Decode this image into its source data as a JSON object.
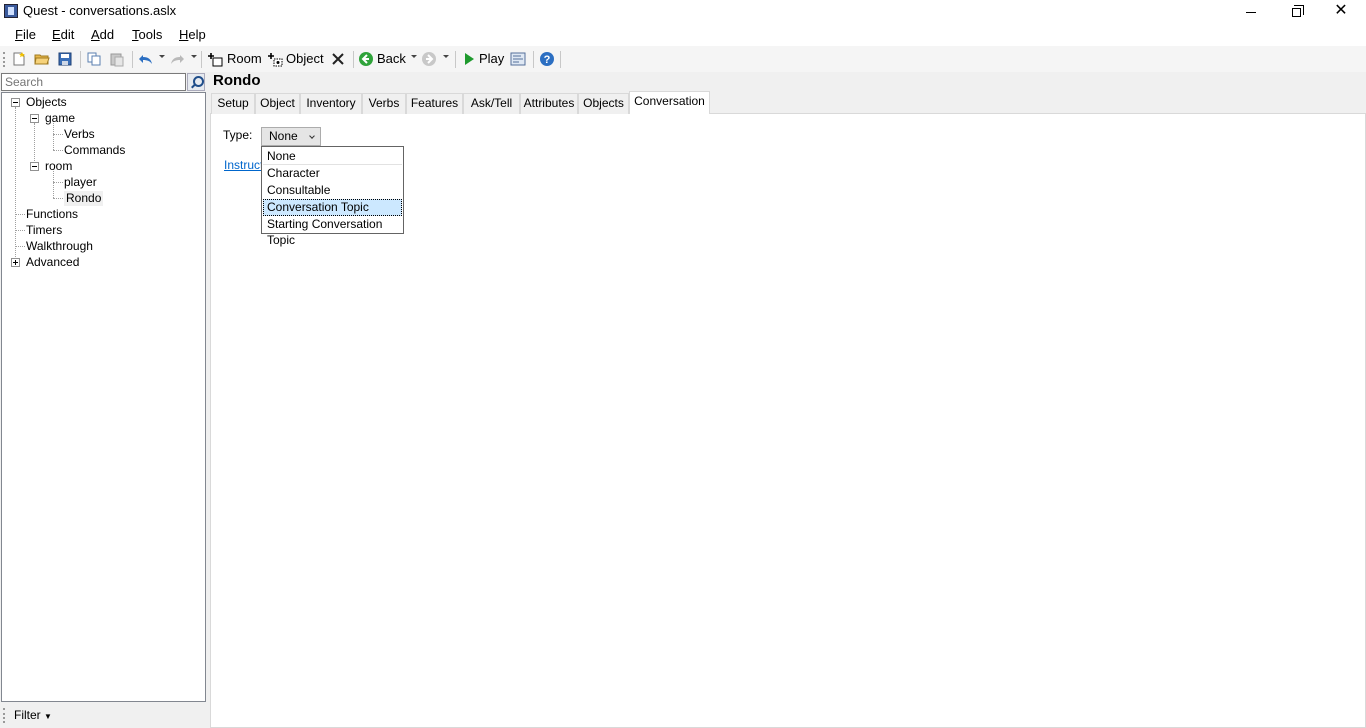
{
  "window": {
    "title": "Quest - conversations.aslx",
    "minimize_icon": "minimize-icon",
    "maximize_icon": "restore-icon",
    "close_glyph": "✕"
  },
  "menu": [
    {
      "label": "File",
      "accel": "F",
      "rest": "ile"
    },
    {
      "label": "Edit",
      "accel": "E",
      "rest": "dit"
    },
    {
      "label": "Add",
      "accel": "A",
      "rest": "dd"
    },
    {
      "label": "Tools",
      "accel": "T",
      "rest": "ools"
    },
    {
      "label": "Help",
      "accel": "H",
      "rest": "elp"
    }
  ],
  "toolbar": {
    "add_room": "Room",
    "add_object": "Object",
    "back": "Back",
    "play": "Play"
  },
  "search": {
    "placeholder": "Search"
  },
  "tree": {
    "objects": "Objects",
    "game": "game",
    "verbs": "Verbs",
    "commands": "Commands",
    "room": "room",
    "player": "player",
    "rondo": "Rondo",
    "functions": "Functions",
    "timers": "Timers",
    "walkthrough": "Walkthrough",
    "advanced": "Advanced"
  },
  "filter": {
    "label": "Filter"
  },
  "editor": {
    "title": "Rondo",
    "tabs": [
      "Setup",
      "Object",
      "Inventory",
      "Verbs",
      "Features",
      "Ask/Tell",
      "Attributes",
      "Objects",
      "Conversation"
    ],
    "active_tab": "Conversation",
    "type_label": "Type:",
    "type_value": "None",
    "instructions_link": "Instructi",
    "type_options": [
      "None",
      "Character",
      "Consultable",
      "Conversation Topic",
      "Starting Conversation Topic"
    ],
    "highlighted_option": "Conversation Topic"
  }
}
